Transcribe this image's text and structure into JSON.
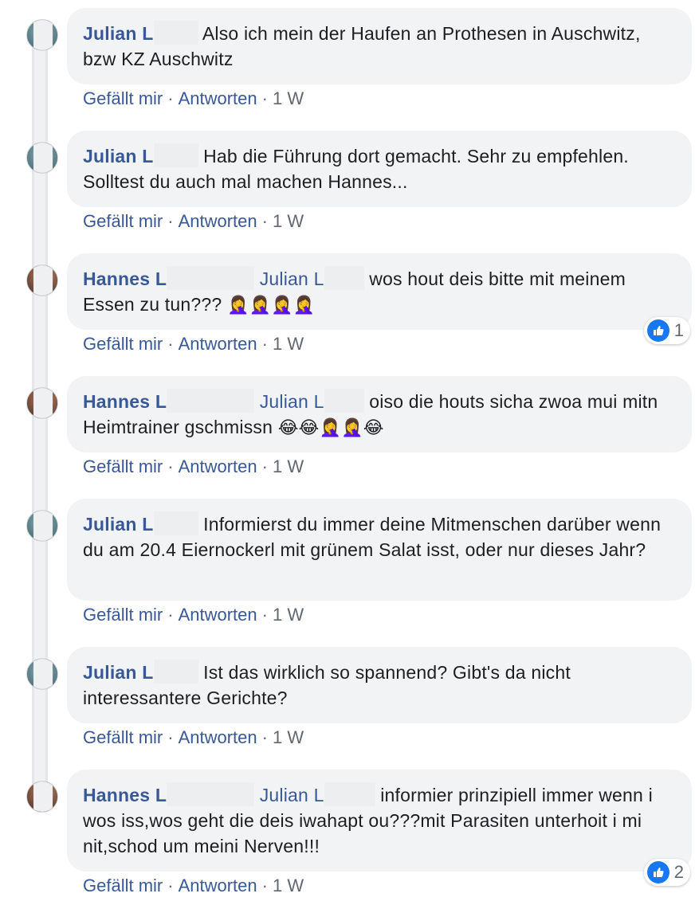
{
  "colors": {
    "link": "#385898",
    "bubble": "#f2f3f5",
    "meta": "#606770",
    "like": "#1877f2"
  },
  "actions": {
    "like": "Gefällt mir",
    "reply": "Antworten",
    "time": "1 W",
    "dot": "·"
  },
  "comments": [
    {
      "author": "Julian L",
      "mention": "",
      "text": "Also ich mein der Haufen an Prothesen in Auschwitz, bzw KZ Auschwitz",
      "emoji": "",
      "reactions": ""
    },
    {
      "author": "Julian L",
      "mention": "",
      "text": "Hab die Führung dort gemacht. Sehr zu empfehlen. Solltest du auch mal machen Hannes...",
      "emoji": "",
      "reactions": ""
    },
    {
      "author": "Hannes L",
      "mention": "Julian L",
      "text": "wos hout deis bitte mit meinem Essen zu tun???",
      "emoji": "🤦‍♀️🤦‍♀️🤦‍♀️🤦‍♀️",
      "reactions": "1"
    },
    {
      "author": "Hannes L",
      "mention": "Julian L",
      "text": "oiso die houts sicha zwoa mui mitn Heimtrainer gschmissn",
      "emoji": "😂😂🤦‍♀️🤦‍♀️😂",
      "reactions": ""
    },
    {
      "author": "Julian L",
      "mention": "",
      "text": "Informierst du immer deine Mitmenschen darüber wenn du am 20.4 Eiernockerl mit grünem Salat isst, oder nur dieses Jahr?",
      "emoji": "",
      "reactions": ""
    },
    {
      "author": "Julian L",
      "mention": "",
      "text": "Ist das wirklich so spannend? Gibt's da nicht interessantere Gerichte?",
      "emoji": "",
      "reactions": ""
    },
    {
      "author": "Hannes L",
      "mention": "Julian L",
      "text": "informier prinzipiell immer wenn i wos iss,wos geht die deis iwahapt ou???mit Parasiten unterhoit i mi nit,schod um meini Nerven!!!",
      "emoji": "",
      "reactions": "2"
    }
  ]
}
